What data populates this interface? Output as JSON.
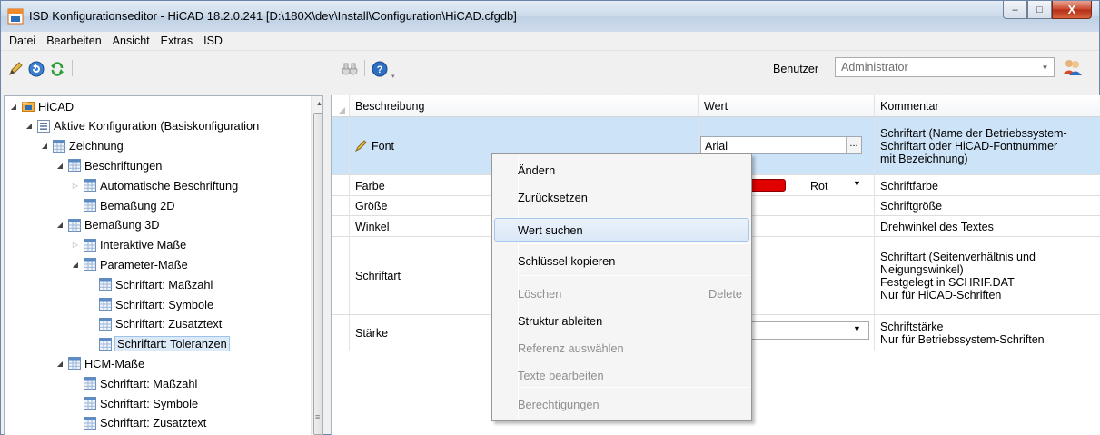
{
  "window": {
    "title": "ISD Konfigurationseditor  - HiCAD 18.2.0.241 [D:\\180X\\dev\\Install\\Configuration\\HiCAD.cfgdb]",
    "minimize": "–",
    "maximize": "□",
    "close": "X"
  },
  "menu": [
    "Datei",
    "Bearbeiten",
    "Ansicht",
    "Extras",
    "ISD"
  ],
  "toolbar": {
    "benutzer_label": "Benutzer",
    "benutzer_value": "Administrator"
  },
  "tree": [
    {
      "label": "HiCAD",
      "icon": "folder-icon",
      "expander": "expanded"
    },
    {
      "label": "Aktive Konfiguration (Basiskonfiguration",
      "icon": "list-icon",
      "expander": "expanded"
    },
    {
      "label": "Zeichnung",
      "icon": "table-icon",
      "expander": "expanded"
    },
    {
      "label": "Beschriftungen",
      "icon": "table-icon",
      "expander": "expanded"
    },
    {
      "label": "Automatische Beschriftung",
      "icon": "table-icon",
      "expander": "collapsed"
    },
    {
      "label": "Bemaßung 2D",
      "icon": "table-icon",
      "expander": "none"
    },
    {
      "label": "Bemaßung 3D",
      "icon": "table-icon",
      "expander": "expanded"
    },
    {
      "label": "Interaktive Maße",
      "icon": "table-icon",
      "expander": "collapsed"
    },
    {
      "label": "Parameter-Maße",
      "icon": "table-icon",
      "expander": "expanded"
    },
    {
      "label": "Schriftart: Maßzahl",
      "icon": "table-icon",
      "expander": "none"
    },
    {
      "label": "Schriftart: Symbole",
      "icon": "table-icon",
      "expander": "none"
    },
    {
      "label": "Schriftart: Zusatztext",
      "icon": "table-icon",
      "expander": "none"
    },
    {
      "label": "Schriftart: Toleranzen",
      "icon": "table-icon",
      "expander": "none",
      "selected": true
    },
    {
      "label": "HCM-Maße",
      "icon": "table-icon",
      "expander": "expanded"
    },
    {
      "label": "Schriftart: Maßzahl",
      "icon": "table-icon",
      "expander": "none"
    },
    {
      "label": "Schriftart: Symbole",
      "icon": "table-icon",
      "expander": "none"
    },
    {
      "label": "Schriftart: Zusatztext",
      "icon": "table-icon",
      "expander": "none"
    }
  ],
  "grid": {
    "headers": {
      "beschreibung": "Beschreibung",
      "wert": "Wert",
      "kommentar": "Kommentar"
    },
    "rows": [
      {
        "beschreibung": "Font",
        "wert": "Arial",
        "kommentar": [
          "Schriftart (Name der Betriebssystem-",
          "Schriftart oder HiCAD-Fontnummer",
          "mit Bezeichnung)"
        ]
      },
      {
        "beschreibung": "Farbe",
        "wert": "Rot",
        "kommentar": [
          "Schriftfarbe"
        ]
      },
      {
        "beschreibung": "Größe",
        "wert": "",
        "kommentar": [
          "Schriftgröße"
        ]
      },
      {
        "beschreibung": "Winkel",
        "wert": "",
        "kommentar": [
          "Drehwinkel des Textes"
        ]
      },
      {
        "beschreibung": "Schriftart",
        "wert": "",
        "kommentar": [
          "Schriftart (Seitenverhältnis und",
          "Neigungswinkel)",
          "Festgelegt in SCHRIF.DAT",
          "Nur für HiCAD-Schriften"
        ]
      },
      {
        "beschreibung": "Stärke",
        "wert": "",
        "kommentar": [
          "Schriftstärke",
          "Nur für Betriebssystem-Schriften"
        ]
      }
    ],
    "value_button": "...",
    "farbe_color": "#e10000"
  },
  "context_menu": {
    "items": [
      {
        "label": "Ändern",
        "disabled": false
      },
      {
        "label": "Zurücksetzen",
        "disabled": false
      },
      {
        "label": "Wert suchen",
        "disabled": false,
        "hover": true
      },
      {
        "label": "Schlüssel kopieren",
        "disabled": false
      },
      {
        "label": "Löschen",
        "shortcut": "Delete",
        "disabled": true
      },
      {
        "label": "Struktur ableiten",
        "disabled": false
      },
      {
        "label": "Referenz auswählen",
        "disabled": true
      },
      {
        "label": "Texte bearbeiten",
        "disabled": true
      },
      {
        "label": "Berechtigungen",
        "disabled": true
      }
    ]
  },
  "colors": {
    "selection": "#cde3f7",
    "title_bar": "#cbdaea",
    "close_button": "#c9452b"
  }
}
